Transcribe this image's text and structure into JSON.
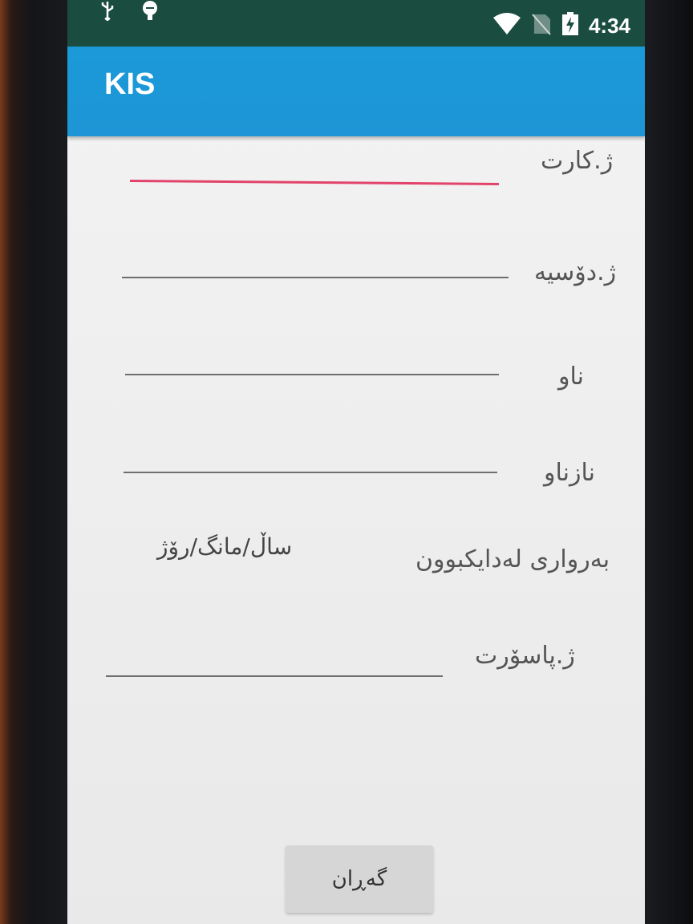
{
  "status_bar": {
    "time": "4:34",
    "icons": [
      "usb-icon",
      "android-debug-icon",
      "wifi-icon",
      "no-sim-icon",
      "battery-charging-icon"
    ]
  },
  "app_bar": {
    "title": "KIS"
  },
  "form": {
    "card_number_label": "ژ.کارت",
    "dossier_number_label": "ژ.دۆسیە",
    "name_label": "ناو",
    "nickname_label": "نازناو",
    "birthdate_label": "بەرواری لەدایکبوون",
    "birthdate_hint": "ساڵ/مانگ/رۆژ",
    "passport_number_label": "ژ.پاسۆرت",
    "card_number_value": "",
    "dossier_number_value": "",
    "name_value": "",
    "nickname_value": "",
    "passport_number_value": ""
  },
  "search_button_label": "گەڕان",
  "colors": {
    "status_bar": "#1a4d3f",
    "app_bar": "#1a9ad9",
    "focused_underline": "#e2436a",
    "underline": "#6e6e6e",
    "button": "#d6d6d6"
  }
}
